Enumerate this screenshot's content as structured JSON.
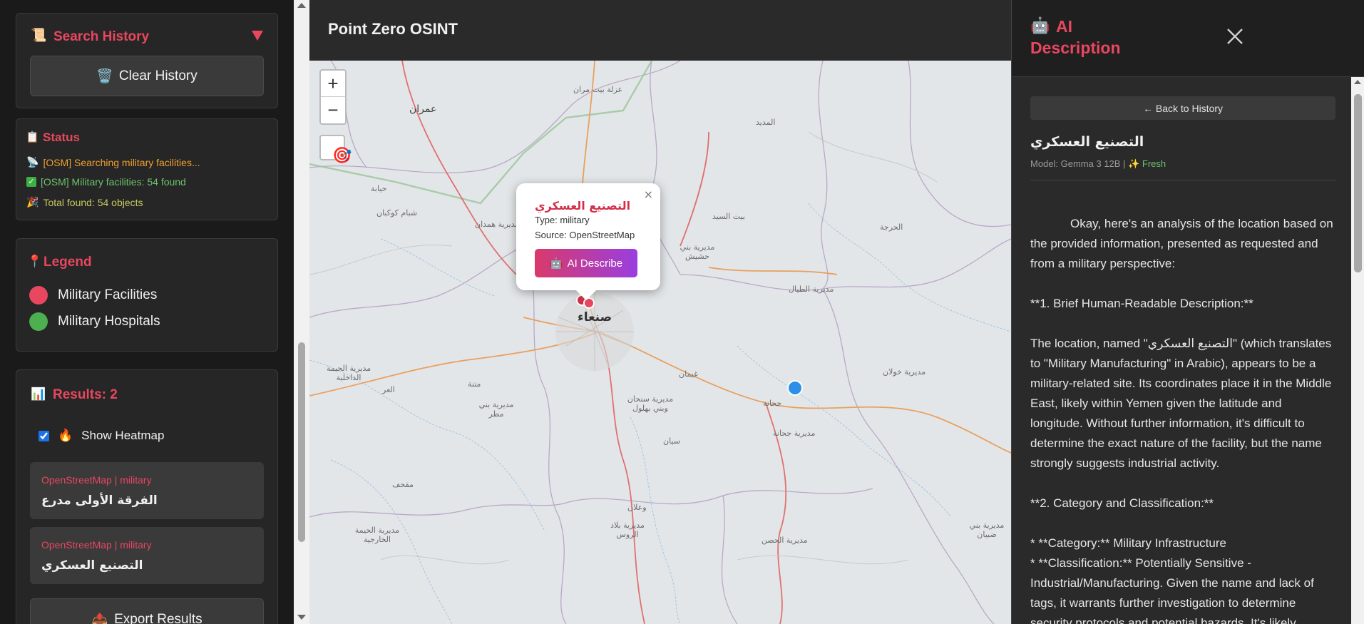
{
  "app": {
    "title": "Point Zero OSINT"
  },
  "search_history": {
    "title": "Search History",
    "clear_label": "Clear History"
  },
  "status": {
    "title": "Status",
    "lines": [
      {
        "text": "[OSM] Searching military facilities...",
        "color": "#f0a030"
      },
      {
        "text": "[OSM] Military facilities: 54 found",
        "color": "#6cc36c"
      },
      {
        "text": "Total found: 54 objects",
        "color": "#c8c860"
      }
    ]
  },
  "legend": {
    "title": "Legend",
    "items": [
      {
        "label": "Military Facilities",
        "color": "#e8475f"
      },
      {
        "label": "Military Hospitals",
        "color": "#4caf50"
      }
    ]
  },
  "results": {
    "title": "Results: 2",
    "heatmap_label": "Show Heatmap",
    "heatmap_checked": true,
    "items": [
      {
        "source": "OpenStreetMap | military",
        "name": "الفرقة الأولى مدرع"
      },
      {
        "source": "OpenStreetMap | military",
        "name": "التصنيع العسكري"
      }
    ],
    "export_label": "Export Results"
  },
  "map": {
    "zoom_in": "+",
    "zoom_out": "−",
    "labels": {
      "amran": "عمران",
      "izla": "عزلة بيت مران",
      "madid": "المديد",
      "hayba": "حيابة",
      "shibam": "شبام كوكبان",
      "hamdan": "مديرية همدان",
      "bayt_sayed": "بيت السيد",
      "harja": "الحرجة",
      "bani_hushaysh": "مديرية بني حشيش",
      "tayal": "مديرية الطيال",
      "sanaa": "صنعاء",
      "haymah_dakhiliyah": "مديرية الحيمة الداخلية",
      "mutnah": "متنة",
      "ghayman": "غيمان",
      "khawlan": "مديرية خولان",
      "bani_matar": "مديرية بني مطر",
      "sanhan": "مديرية سنحان وبني بهلول",
      "jahana": "جحانة",
      "jahana_dist": "مديرية جحانة",
      "sayan": "سيان",
      "maqhaf": "مقحف",
      "waalan": "وعلان",
      "haymah_kharijiyah": "مديرية الحيمة الخارجية",
      "bilad_rus": "مديرية بلاد الروس",
      "husn": "مديرية الحصن",
      "bani_dabyan": "مديرية بني ضبيان",
      "ur": "العر"
    }
  },
  "popup": {
    "title": "التصنيع العسكري",
    "type_line": "Type: military",
    "source_line": "Source: OpenStreetMap",
    "ai_button": "AI Describe",
    "close": "×"
  },
  "ai_panel": {
    "title_line1": "AI",
    "title_line2": "Description",
    "back_label": "← Back to History",
    "name": "التصنيع العسكري",
    "model_text": "Model: Gemma 3 12B |",
    "fresh_label": "Fresh",
    "paragraphs": [
      "Okay, here's an analysis of the location based on the provided information, presented as requested and from a military perspective:",
      "**1. Brief Human-Readable Description:**",
      "The location, named \"التصنيع العسكري\" (which translates to \"Military Manufacturing\" in Arabic), appears to be a military-related site. Its coordinates place it in the Middle East, likely within Yemen given the latitude and longitude. Without further information, it's difficult to determine the exact nature of the facility, but the name strongly suggests industrial activity.",
      "**2. Category and Classification:**"
    ],
    "bullets": [
      "*   **Category:** Military Infrastructure",
      "*   **Classification:** Potentially Sensitive - Industrial/Manufacturing.  Given the name and lack of tags, it warrants further investigation to determine security protocols and potential hazards.  It's likely"
    ]
  },
  "colors": {
    "accent": "#e8475f",
    "military": "#e8475f",
    "hospital": "#4caf50"
  }
}
